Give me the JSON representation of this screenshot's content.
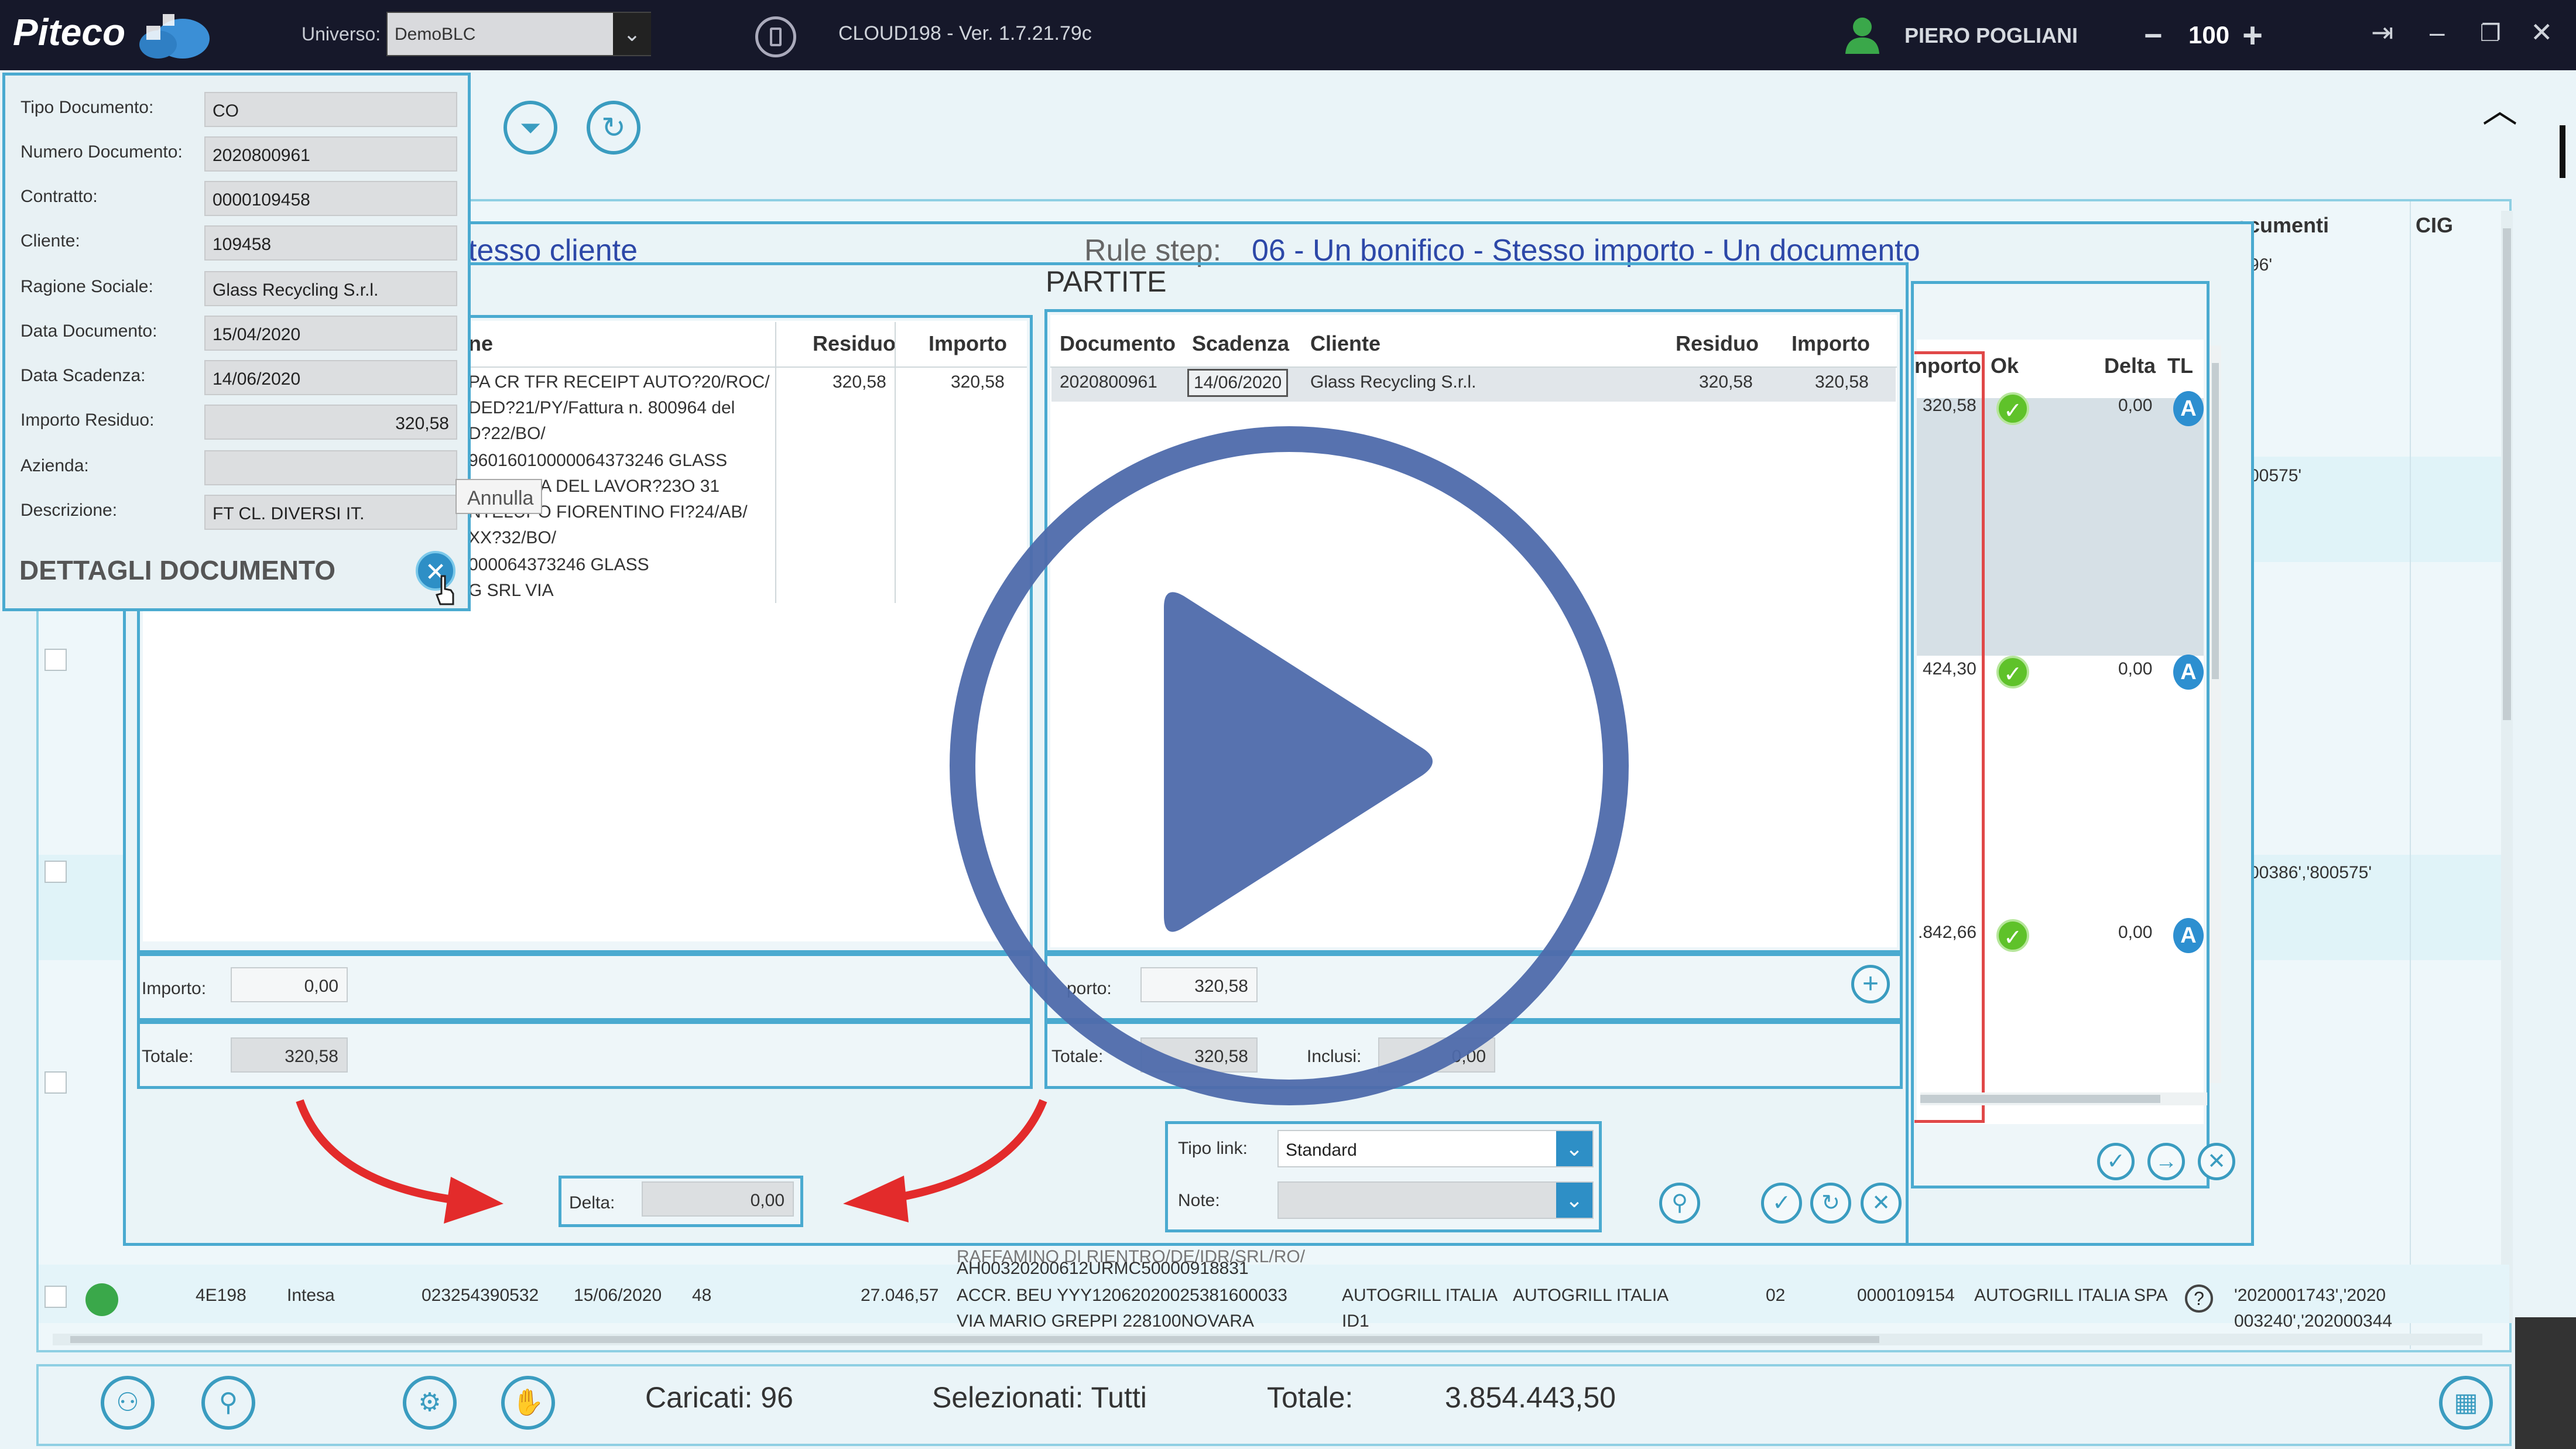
{
  "app": {
    "logo": "Piteco",
    "universe_label": "Universo:",
    "universe_value": "DemoBLC",
    "version": "CLOUD198 - Ver. 1.7.21.79c",
    "user_name": "PIERO POGLIANI",
    "zoom": "100",
    "zoom_minus": "−",
    "zoom_plus": "+"
  },
  "detail": {
    "fields": [
      {
        "label": "Tipo Documento:",
        "value": "CO"
      },
      {
        "label": "Numero Documento:",
        "value": "2020800961"
      },
      {
        "label": "Contratto:",
        "value": "0000109458"
      },
      {
        "label": "Cliente:",
        "value": "109458"
      },
      {
        "label": "Ragione Sociale:",
        "value": "Glass Recycling S.r.l."
      },
      {
        "label": "Data Documento:",
        "value": "15/04/2020"
      },
      {
        "label": "Data Scadenza:",
        "value": "14/06/2020"
      },
      {
        "label": "Importo Residuo:",
        "value": "320,58"
      },
      {
        "label": "Azienda:",
        "value": ""
      },
      {
        "label": "Descrizione:",
        "value": "FT CL. DIVERSI IT."
      }
    ],
    "title": "DETTAGLI DOCUMENTO",
    "annulla": "Annulla"
  },
  "dialog": {
    "rule_prefix": "tesso cliente",
    "rule_label": "Rule step:",
    "rule_value": "06 - Un bonifico - Stesso importo - Un documento",
    "partite_title": "PARTITE",
    "left": {
      "headers": [
        "ne",
        "Residuo",
        "Importo"
      ],
      "desc_lines": [
        "PA CR TFR RECEIPT AUTO?20/ROC/",
        "DED?21/PY/Fattura n. 800964 del",
        "D?22/BO/",
        "96016010000064373246 GLASS",
        "S SRL VIA DEL LAVOR?23O 31",
        "NTELUPO FIORENTINO FI?24/AB/",
        "XX?32/BO/",
        "000064373246 GLASS",
        "G SRL VIA"
      ],
      "residuo": "320,58",
      "importo": "320,58",
      "importo_label": "Importo:",
      "importo_value": "0,00",
      "totale_label": "Totale:",
      "totale_value": "320,58"
    },
    "right": {
      "headers": [
        "Documento",
        "Scadenza",
        "Cliente",
        "Residuo",
        "Importo"
      ],
      "row": {
        "documento": "2020800961",
        "scadenza": "14/06/2020",
        "cliente": "Glass Recycling S.r.l.",
        "residuo": "320,58",
        "importo": "320,58"
      },
      "importo_label": "porto:",
      "importo_value": "320,58",
      "totale_label": "Totale:",
      "totale_value": "320,58",
      "inclusi_label": "Inclusi:",
      "inclusi_value": "0,00"
    },
    "delta_label": "Delta:",
    "delta_value": "0,00",
    "tipo_link_label": "Tipo link:",
    "tipo_link_value": "Standard",
    "note_label": "Note:",
    "note_value": ""
  },
  "mini": {
    "headers": [
      "nporto",
      "Ok",
      "Delta",
      "TL"
    ],
    "rows": [
      {
        "importo": "320,58",
        "delta": "0,00",
        "tl": "A"
      },
      {
        "importo": "424,30",
        "delta": "0,00",
        "tl": "A"
      },
      {
        "importo": ".842,66",
        "delta": "0,00",
        "tl": "A"
      }
    ]
  },
  "background": {
    "col_documenti": "ocumenti",
    "col_cig": "CIG",
    "doc_snippets": [
      "96'",
      "00575'",
      "00386','800575'"
    ],
    "bottom_row": {
      "id": "4E198",
      "bank": "Intesa",
      "account": "023254390532",
      "date": "15/06/2020",
      "code": "48",
      "amount": "27.046,57",
      "desc_lines": [
        "AH00320200612URMC50000918831",
        "ACCR. BEU YYY12062020025381600033",
        "VIA MARIO GREPPI 228100NOVARA"
      ],
      "desc_top": "RAFFAMINO DI RIENTRO/DE/IDR/SRL/RO/",
      "company": "AUTOGRILL ITALIA",
      "company2": "ID1",
      "company_b": "AUTOGRILL ITALIA",
      "num": "02",
      "contract": "0000109154",
      "company_c": "AUTOGRILL ITALIA SPA",
      "docs": "'2020001743','2020",
      "docs2": "003240','202000344"
    }
  },
  "status": {
    "caricati": "Caricati: 96",
    "selezionati": "Selezionati: Tutti",
    "totale_label": "Totale:",
    "totale_value": "3.854.443,50"
  },
  "colors": {
    "accent": "#4aaad0",
    "play": "#4e6aab",
    "arrow": "#e32b2b"
  }
}
